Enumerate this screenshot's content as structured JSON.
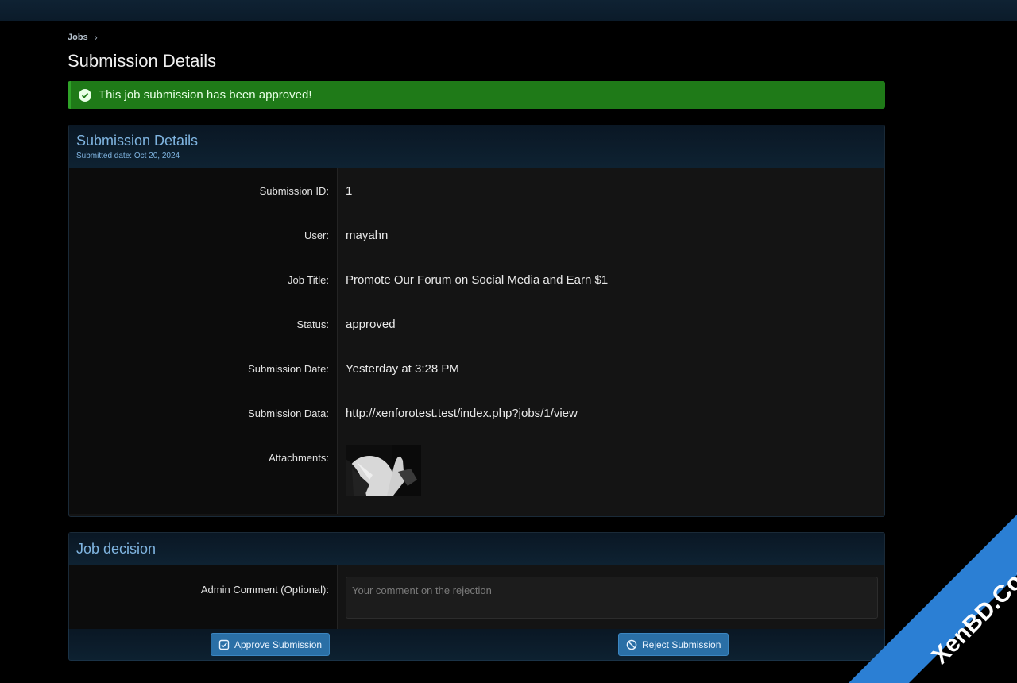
{
  "breadcrumb": {
    "item": "Jobs",
    "separator": "›"
  },
  "page": {
    "title": "Submission Details"
  },
  "alert": {
    "message": "This job submission has been approved!",
    "color": "#1f7a18"
  },
  "details": {
    "title": "Submission Details",
    "subtitle": "Submitted date: Oct 20, 2024",
    "rows": [
      {
        "label": "Submission ID:",
        "value": "1"
      },
      {
        "label": "User:",
        "value": "mayahn"
      },
      {
        "label": "Job Title:",
        "value": "Promote Our Forum on Social Media and Earn $1"
      },
      {
        "label": "Status:",
        "value": "approved"
      },
      {
        "label": "Submission Date:",
        "value": "Yesterday at 3:28 PM"
      },
      {
        "label": "Submission Data:",
        "value": "http://xenforotest.test/index.php?jobs/1/view"
      },
      {
        "label": "Attachments:",
        "value": ""
      }
    ]
  },
  "decision": {
    "title": "Job decision",
    "comment_label": "Admin Comment (Optional):",
    "comment_placeholder": "Your comment on the rejection",
    "approve_label": "Approve Submission",
    "reject_label": "Reject Submission"
  },
  "watermark": {
    "text": "XenBD.Com",
    "color": "#2b7fd4"
  },
  "icons": {
    "alert": "check-circle-icon",
    "approve": "check-square-icon",
    "reject": "ban-icon"
  }
}
